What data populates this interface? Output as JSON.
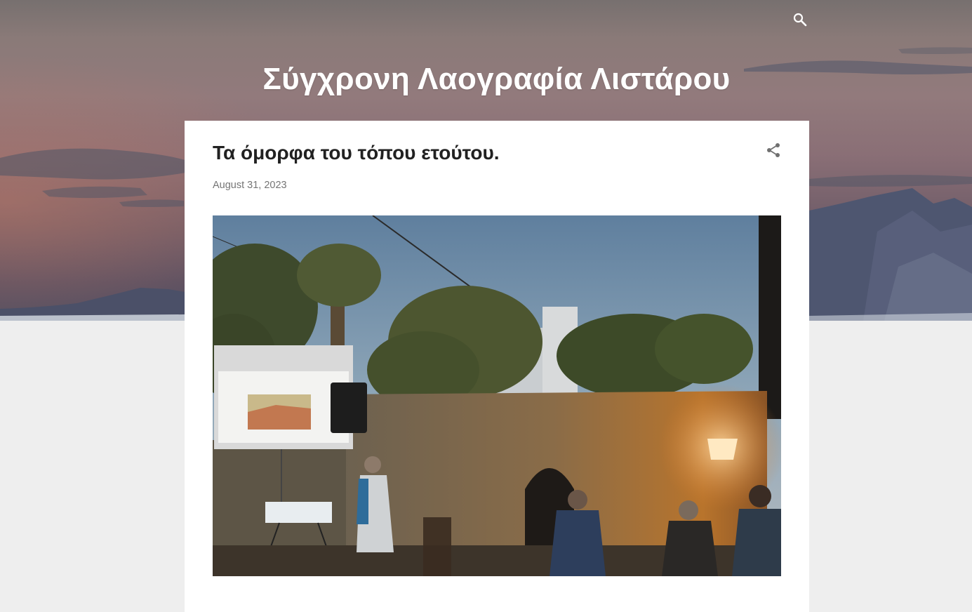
{
  "header": {
    "blog_title": "Σύγχρονη Λαογραφία Λιστάρου",
    "search_icon": "search-icon"
  },
  "post": {
    "title": "Τα όμορφα του τόπου ετούτου.",
    "date": "August 31, 2023",
    "share_icon": "share-icon"
  },
  "colors": {
    "page_background": "#eeeeee",
    "card_background": "#ffffff",
    "title_text": "#212121",
    "date_text": "#757575",
    "header_text": "#ffffff"
  }
}
